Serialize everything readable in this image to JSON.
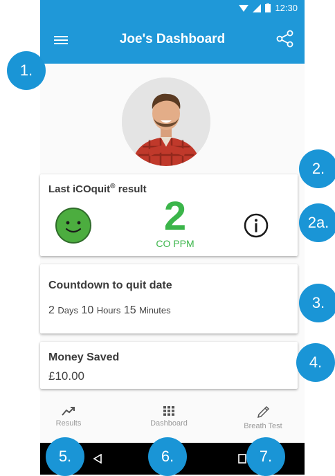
{
  "status_bar": {
    "time": "12:30"
  },
  "app_bar": {
    "title": "Joe's  Dashboard"
  },
  "last_result": {
    "title": "Last iCOquit",
    "reg_mark": "®",
    "title_suffix": " result",
    "value": "2",
    "unit": "CO PPM"
  },
  "countdown": {
    "title": "Countdown to quit date",
    "days_value": "2",
    "days_label": "Days",
    "hours_value": "10",
    "hours_label": "Hours",
    "minutes_value": "15",
    "minutes_label": "Minutes"
  },
  "money": {
    "title": "Money Saved",
    "value": "£10.00"
  },
  "nav": [
    {
      "label": "Results",
      "icon": "trending-up-icon"
    },
    {
      "label": "Dashboard",
      "icon": "grid-icon"
    },
    {
      "label": "Breath Test",
      "icon": "pencil-icon"
    }
  ],
  "badges": [
    "1.",
    "2.",
    "2a.",
    "3.",
    "4.",
    "5.",
    "6.",
    "7."
  ],
  "colors": {
    "primary": "#1f98d8",
    "badge": "#1a95d6",
    "good": "#3bb54a",
    "smiley": "#4cad3f"
  }
}
